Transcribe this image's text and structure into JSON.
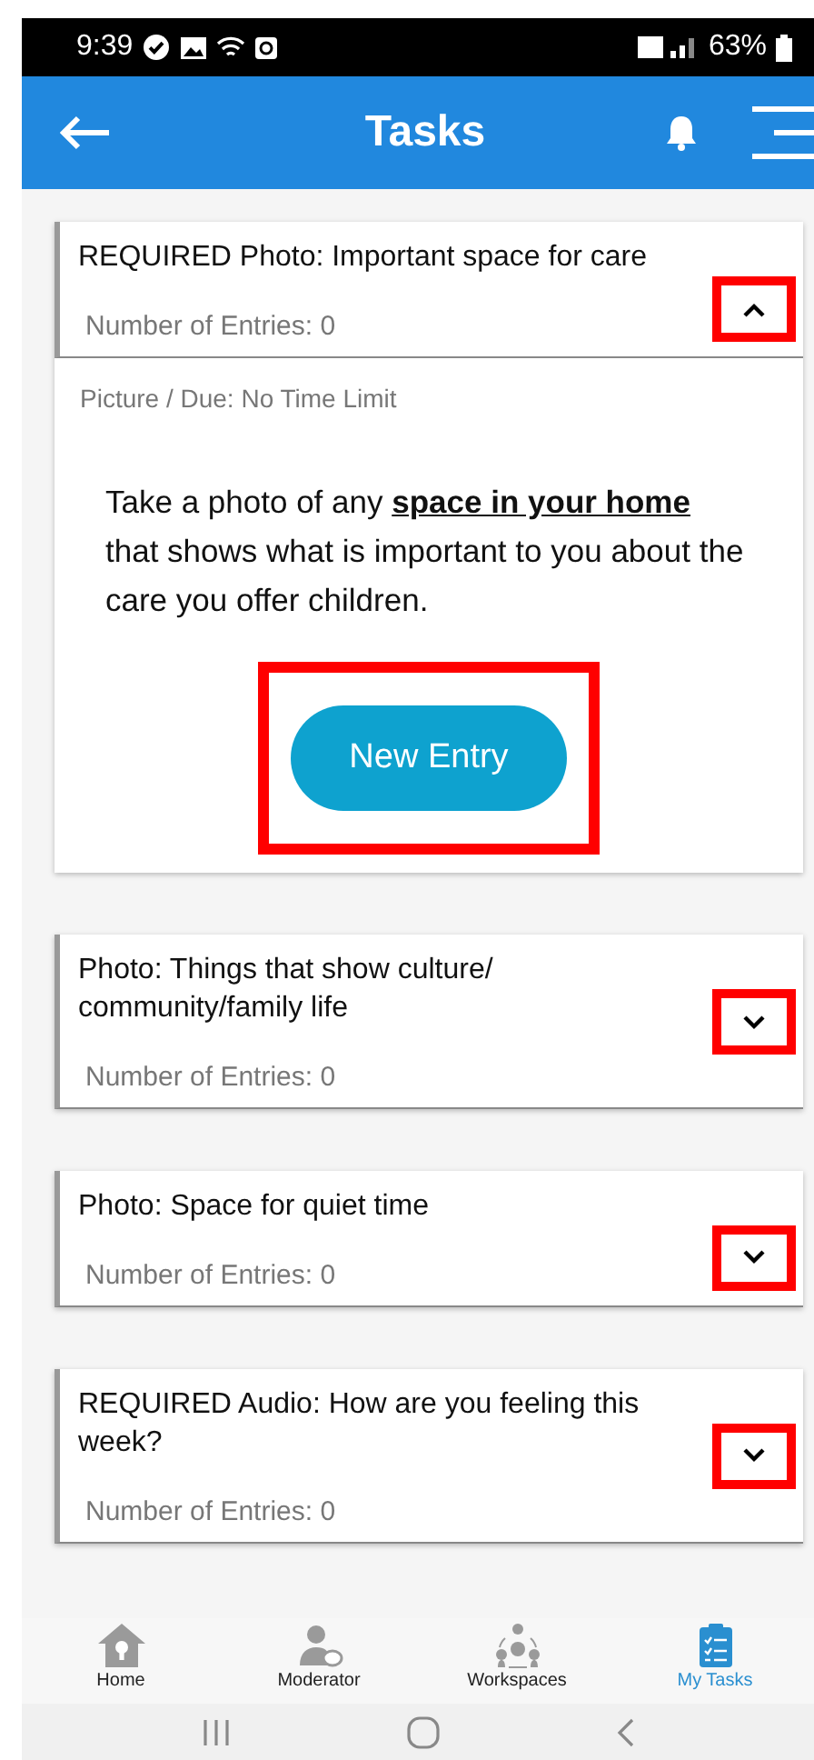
{
  "status_bar": {
    "time": "9:39",
    "battery": "63%"
  },
  "app_bar": {
    "title": "Tasks"
  },
  "tasks": [
    {
      "title": "REQUIRED Photo: Important space for care",
      "entries": "Number of Entries: 0",
      "expanded": true,
      "toggle_highlighted": true,
      "detail": {
        "meta": "Picture / Due: No Time Limit",
        "description": "Take a photo of any **space in your home** that shows what is important to you about the care you offer children.",
        "button": "New Entry",
        "button_highlighted": true
      }
    },
    {
      "title": "Photo: Things that show culture/ community/family life",
      "entries": "Number of Entries: 0",
      "expanded": false,
      "toggle_highlighted": true
    },
    {
      "title": "Photo: Space for quiet time",
      "entries": "Number of Entries: 0",
      "expanded": false,
      "toggle_highlighted": true
    },
    {
      "title": "REQUIRED Audio: How are you feeling this week?",
      "entries": "Number of Entries: 0",
      "expanded": false,
      "toggle_highlighted": true
    }
  ],
  "bottom_nav": [
    {
      "label": "Home",
      "kind": "home",
      "selected": false
    },
    {
      "label": "Moderator",
      "kind": "moderator",
      "selected": false
    },
    {
      "label": "Workspaces",
      "kind": "workspaces",
      "selected": false
    },
    {
      "label": "My Tasks",
      "kind": "tasks",
      "selected": true
    }
  ]
}
